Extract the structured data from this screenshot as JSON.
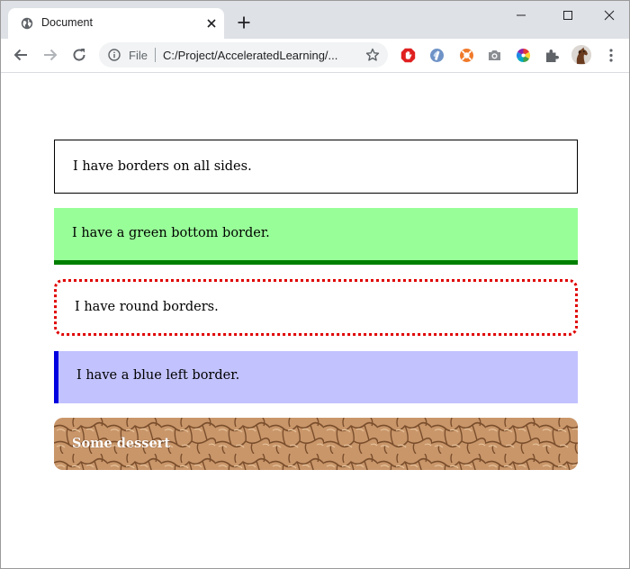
{
  "browser": {
    "tab": {
      "title": "Document"
    },
    "omnibox": {
      "scheme": "File",
      "url": "C:/Project/AcceleratedLearning/..."
    }
  },
  "page": {
    "boxes": [
      {
        "text": "I have borders on all sides."
      },
      {
        "text": "I have a green bottom border."
      },
      {
        "text": "I have round borders."
      },
      {
        "text": "I have a blue left border."
      },
      {
        "text": "Some dessert"
      }
    ]
  },
  "colors": {
    "green_bg": "#98ff98",
    "green_border": "#008000",
    "round_border": "#e00000",
    "blue_bg": "#c2c2ff",
    "blue_border": "#0000e0",
    "dessert_bg": "#c9966a"
  },
  "icons": {
    "tab": [
      "globe-icon",
      "close-icon",
      "new-tab-plus-icon"
    ],
    "window": [
      "minimize-icon",
      "maximize-icon",
      "window-close-icon"
    ],
    "toolbar": [
      "back-arrow-icon",
      "forward-arrow-icon",
      "reload-icon",
      "info-icon",
      "star-icon",
      "menu-dots-icon"
    ],
    "extensions": [
      "adblock-icon",
      "dictionary-icon",
      "orange-extension-icon",
      "camera-icon",
      "color-wheel-icon",
      "puzzle-icon"
    ]
  }
}
